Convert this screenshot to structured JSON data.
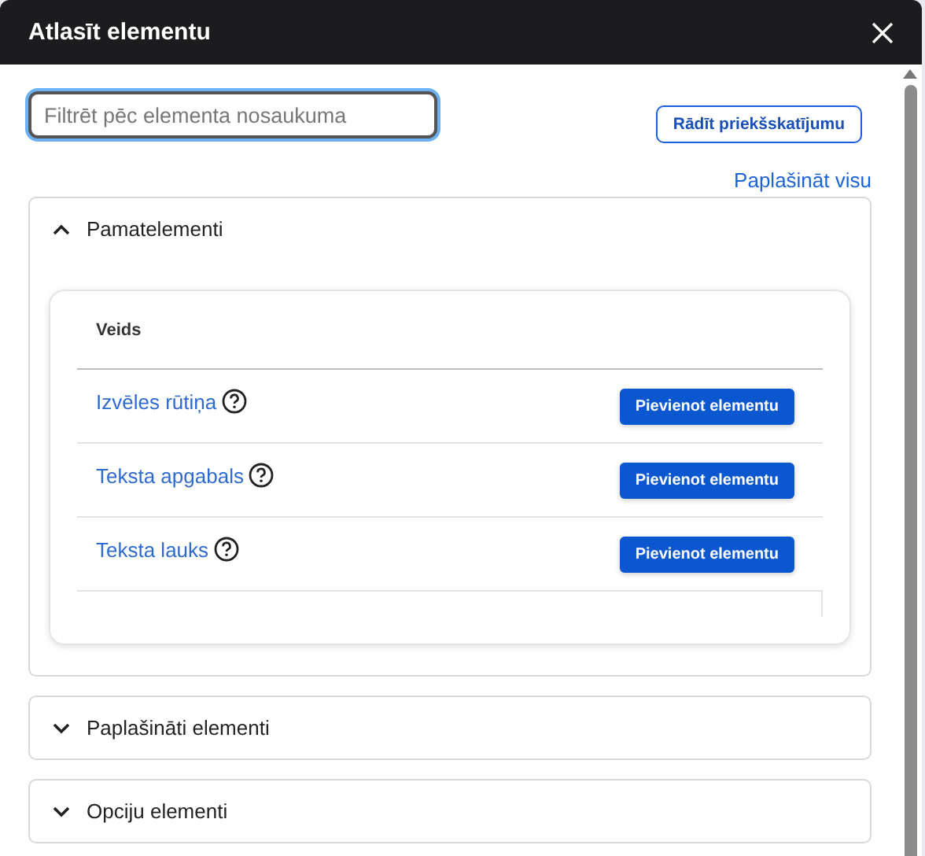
{
  "window": {
    "title": "Atlasīt elementu"
  },
  "search": {
    "placeholder": "Filtrēt pēc elementa nosaukuma"
  },
  "preview_button": "Rādīt priekšskatījumu",
  "expand_all": "Paplašināt visu",
  "sections": [
    {
      "title": "Pamatelementi",
      "expanded": true,
      "table": {
        "column": "Veids",
        "rows": [
          {
            "name": "Izvēles rūtiņa",
            "button": "Pievienot elementu"
          },
          {
            "name": "Teksta apgabals",
            "button": "Pievienot elementu"
          },
          {
            "name": "Teksta lauks",
            "button": "Pievienot elementu"
          }
        ]
      }
    },
    {
      "title": "Paplašināti elementi",
      "expanded": false
    },
    {
      "title": "Opciju elementi",
      "expanded": false
    }
  ]
}
